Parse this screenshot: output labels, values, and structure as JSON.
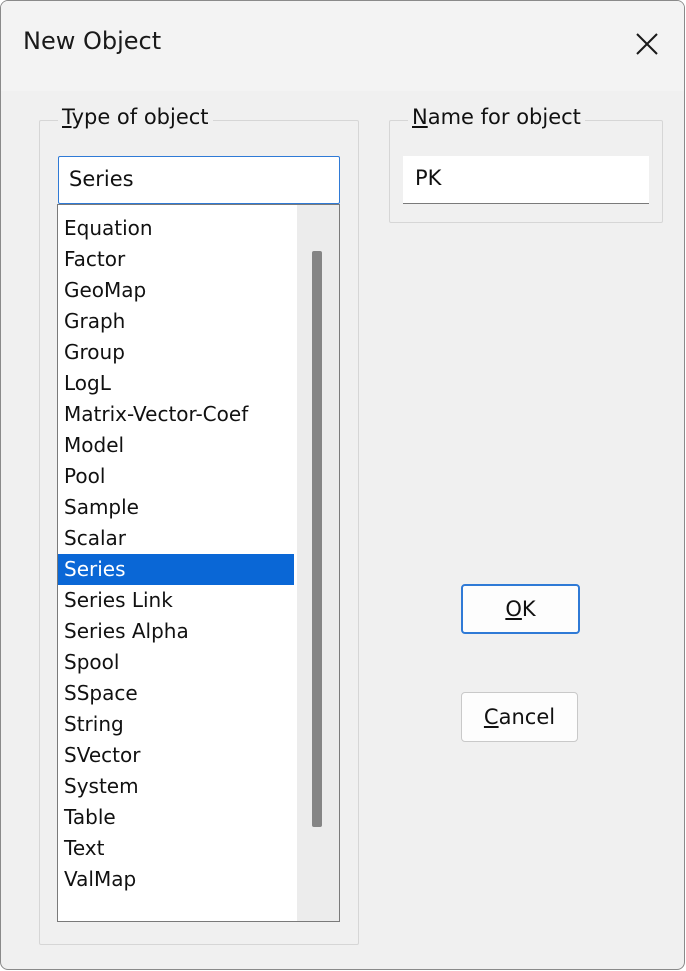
{
  "window": {
    "title": "New Object"
  },
  "type_group": {
    "legend_mnemonic": "T",
    "legend_rest": "ype of object",
    "selected_value": "Series",
    "items": [
      "Equation",
      "Factor",
      "GeoMap",
      "Graph",
      "Group",
      "LogL",
      "Matrix-Vector-Coef",
      "Model",
      "Pool",
      "Sample",
      "Scalar",
      "Series",
      "Series Link",
      "Series Alpha",
      "Spool",
      "SSpace",
      "String",
      "SVector",
      "System",
      "Table",
      "Text",
      "ValMap"
    ],
    "selected_index": 11
  },
  "name_group": {
    "legend_mnemonic": "N",
    "legend_rest": "ame for object",
    "value": "PK"
  },
  "buttons": {
    "ok_mnemonic": "O",
    "ok_rest": "K",
    "cancel_mnemonic": "C",
    "cancel_rest": "ancel"
  },
  "colors": {
    "selection": "#0a67d6",
    "focus_border": "#2f7ad6"
  }
}
